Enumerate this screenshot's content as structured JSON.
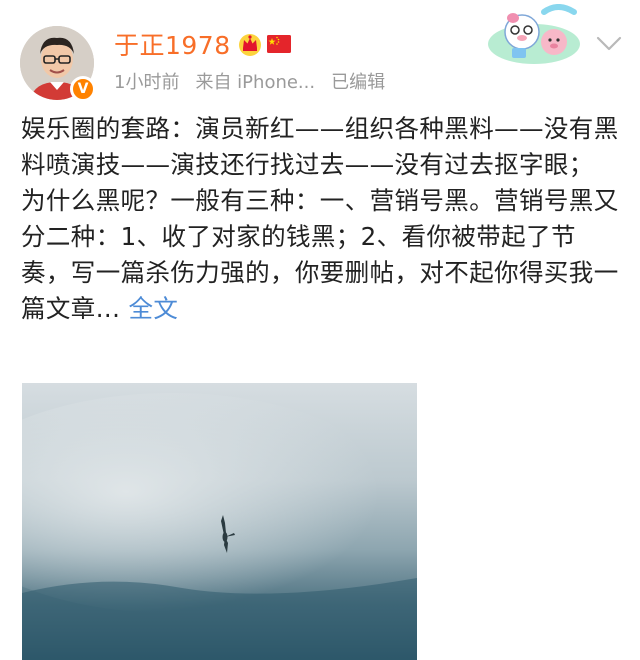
{
  "user": {
    "name": "于正1978",
    "verified_badge": "V"
  },
  "meta": {
    "time": "1小时前",
    "source": "来自 iPhone...",
    "edited": "已编辑"
  },
  "post": {
    "line_1": "娱乐圈的套路：演员新红——组织各种黑料——没有黑料喷演技——演技还行找过去——没有过去抠字眼；",
    "line_2": "为什么黑呢？一般有三种：一、营销号黑。营销号黑又分二种：1、收了对家的钱黑；2、看你被带起了节奏，写一篇杀伤力强的，你要删帖，对不起你得买我一篇文章...",
    "more_label": "全文"
  },
  "colors": {
    "username": "#f86e28",
    "meta": "#9a9a9a",
    "link": "#4d8bd6",
    "badge": "#ff8200"
  },
  "icons": [
    "crown-icon",
    "china-flag-icon",
    "chevron-down-icon",
    "sticker-icon"
  ]
}
